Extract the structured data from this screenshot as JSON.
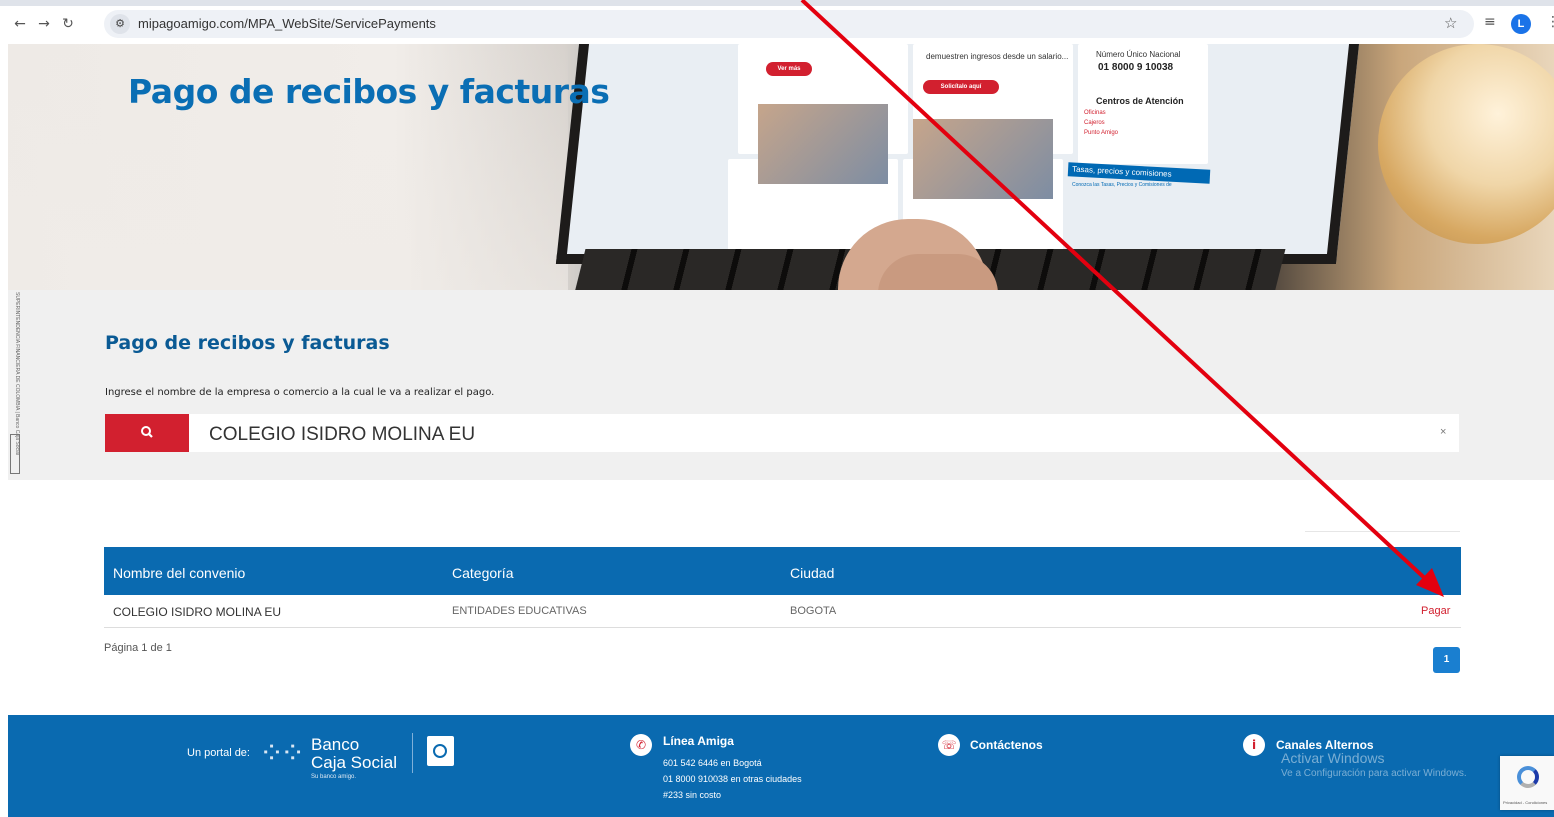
{
  "browser": {
    "url": "mipagoamigo.com/MPA_WebSite/ServicePayments",
    "profile_initial": "L"
  },
  "hero": {
    "title": "Pago de recibos y facturas",
    "screen_text_1": "demuestren ingresos desde un salario...",
    "screen_number_label": "Número Único Nacional",
    "screen_number": "01 8000 9 10038",
    "screen_centers": "Centros de Atención",
    "screen_links": [
      "Oficinas",
      "Cajeros",
      "Punto Amigo"
    ],
    "screen_btn_1": "Ver más",
    "screen_btn_2": "Solicítalo aquí",
    "screen_bar": "Tasas, precios y comisiones",
    "screen_bar_sub": "Conozca las Tasas, Precios y Comisiones de"
  },
  "side": {
    "text": "SUPERINTENDENCIA FINANCIERA DE COLOMBIA | Banco Caja Social",
    "logo": "VIGILADO"
  },
  "search": {
    "title": "Pago de recibos y facturas",
    "hint": "Ingrese el nombre de la empresa o comercio a la cual le va a realizar el pago.",
    "value": "COLEGIO ISIDRO MOLINA EU",
    "clear": "×"
  },
  "table": {
    "headers": [
      "Nombre del convenio",
      "Categoría",
      "Ciudad"
    ],
    "rows": [
      {
        "name": "COLEGIO ISIDRO MOLINA EU",
        "category": "ENTIDADES EDUCATIVAS",
        "city": "BOGOTA",
        "action": "Pagar"
      }
    ],
    "page_info": "Página 1 de 1",
    "current_page": "1"
  },
  "footer": {
    "portal_label": "Un portal de:",
    "bank_line1": "Banco",
    "bank_line2": "Caja Social",
    "bank_tagline": "Su banco amigo.",
    "linea_title": "Línea Amiga",
    "linea_lines": [
      "601 542 6446 en Bogotá",
      "01 8000 910038 en otras ciudades",
      "#233 sin costo"
    ],
    "contact_title": "Contáctenos",
    "canales_title": "Canales Alternos",
    "watermark_title": "Activar Windows",
    "watermark_sub": "Ve a Configuración para activar Windows.",
    "recaptcha_text": "Privacidad - Condiciones"
  },
  "colors": {
    "brand_blue": "#0a6ab0",
    "brand_red": "#d2202f",
    "panel_bg": "#f0f0f0"
  }
}
